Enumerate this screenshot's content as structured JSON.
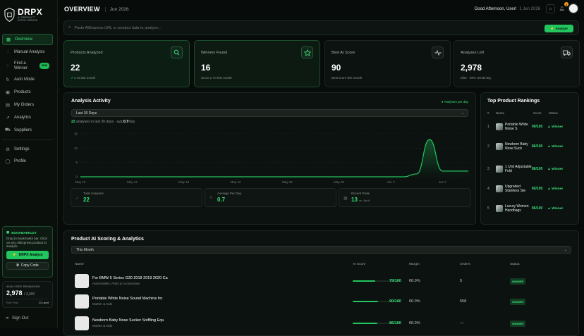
{
  "brand": {
    "name": "DRPX",
    "tagline": "AI PRODUCT INTELLIGENCE"
  },
  "sidebar": {
    "items": [
      {
        "label": "Overview",
        "icon": "grid-icon"
      },
      {
        "label": "Manual Analysis",
        "icon": "chart-icon"
      },
      {
        "label": "Find a Winner",
        "icon": "bulb-icon",
        "badge": "NEW"
      },
      {
        "label": "Auto Mode",
        "icon": "refresh-icon"
      },
      {
        "label": "Products",
        "icon": "box-icon"
      },
      {
        "label": "My Orders",
        "icon": "cart-icon"
      },
      {
        "label": "Analytics",
        "icon": "analytics-icon"
      },
      {
        "label": "Suppliers",
        "icon": "truck-icon"
      },
      {
        "label": "Settings",
        "icon": "gear-icon"
      },
      {
        "label": "Profile",
        "icon": "user-icon"
      }
    ],
    "bookmarklet": {
      "title": "BOOKMARKLET",
      "desc": "Drag to bookmarks bar. Click on any AliExpress product to analyze.",
      "drag_label": "DRPX Analyze",
      "copy_label": "Copy Code"
    },
    "remaining": {
      "label": "ANALYSES REMAINING",
      "value": "2,978",
      "total": "/ 3,000",
      "plan": "Elite Plan",
      "used": "22 used"
    },
    "signout": "Sign Out"
  },
  "header": {
    "title": "OVERVIEW",
    "date": "Jun 2026",
    "greeting": "Good Afternoon, User!",
    "greeting_date": "1 Jun 2026",
    "notif_count": "3"
  },
  "search": {
    "placeholder": "Paste AliExpress URL or product data to analyze...",
    "button": "Analyze"
  },
  "stats": [
    {
      "label": "Products Analyzed",
      "value": "22",
      "sub_up": "↗ 1",
      "sub": " vs last month",
      "icon": "search-icon"
    },
    {
      "label": "Winners Found",
      "value": "16",
      "sub_up": "",
      "sub": "Score ≥ 70 this month",
      "icon": "star-icon"
    },
    {
      "label": "Best AI Score",
      "value": "90",
      "sub_up": "",
      "sub": "Best score this month",
      "icon": "pulse-icon"
    },
    {
      "label": "Analyses Left",
      "value": "2,978",
      "sub_up": "",
      "sub": "Elite · 99% remaining",
      "icon": "truck-icon"
    }
  ],
  "activity": {
    "title": "Analysis Activity",
    "legend": "● Analyses per day",
    "range": "Last 30 Days",
    "count": "22",
    "count_text": " analyses in last 30 days · avg ",
    "avg": "0.7",
    "avg_unit": "/day",
    "mini": [
      {
        "label": "Total Analyses",
        "value": "22",
        "unit": "",
        "icon": "check-icon"
      },
      {
        "label": "Average Per Day",
        "value": "0.7",
        "unit": "",
        "icon": "equal-icon"
      },
      {
        "label": "Recent Peak",
        "value": "13",
        "unit": "on Jun 6",
        "icon": "calendar-icon"
      }
    ]
  },
  "chart_data": {
    "type": "line",
    "x": [
      "May 10",
      "May 11",
      "May 12",
      "May 13",
      "May 14",
      "May 15",
      "May 16",
      "May 17",
      "May 18",
      "May 19",
      "May 20",
      "May 21",
      "May 22",
      "May 23",
      "May 24",
      "May 25",
      "May 26",
      "May 27",
      "May 28",
      "May 29",
      "May 30",
      "May 31",
      "Jun 1",
      "Jun 2",
      "Jun 3",
      "Jun 4",
      "Jun 5",
      "Jun 6",
      "Jun 7",
      "Jun 8",
      "Jun 9"
    ],
    "xticks": [
      "May 10",
      "May 14",
      "May 18",
      "May 22",
      "May 26",
      "May 30",
      "Jun 3",
      "Jun 7"
    ],
    "values": [
      0,
      0,
      0,
      0,
      0,
      0,
      0,
      0,
      0,
      0,
      0,
      0,
      0,
      0,
      0,
      0,
      0,
      0,
      0,
      0,
      0,
      0,
      0,
      0,
      0,
      0,
      1,
      13,
      2,
      2,
      2
    ],
    "yticks": [
      0,
      5,
      10,
      15
    ],
    "ylim": [
      0,
      15
    ],
    "grid": true,
    "series_color": "#22c55e"
  },
  "rankings": {
    "title": "Top Product Rankings",
    "headers": [
      "#",
      "Name",
      "Score",
      "Status"
    ],
    "rows": [
      {
        "rank": "1",
        "name": "Portable White Noise S",
        "score": "90/100",
        "status": "▲ Winner"
      },
      {
        "rank": "2",
        "name": "Newborn Baby Nose Suck",
        "score": "86/100",
        "status": "▲ Winner"
      },
      {
        "rank": "3",
        "name": "1 Unit Adjustable Fold",
        "score": "86/100",
        "status": "▲ Winner"
      },
      {
        "rank": "4",
        "name": "Upgraded Stainless Ste",
        "score": "85/100",
        "status": "▲ Winner"
      },
      {
        "rank": "5",
        "name": "Luxury Women Handbags",
        "score": "85/100",
        "status": "▲ Winner"
      }
    ]
  },
  "table": {
    "title": "Product AI Scoring & Analytics",
    "range": "This Month",
    "headers": [
      "Name",
      "AI Score",
      "Margin",
      "Orders",
      "Status"
    ],
    "rows": [
      {
        "name": "For BMW 5 Series G30 2018 2019 2020 Ca",
        "category": "Automobiles, Parts & Accessories",
        "score": "79/100",
        "score_value": 79,
        "margin": "60.0%",
        "orders": "5",
        "status": "WINNER"
      },
      {
        "name": "Portable White Noise Sound Machine for",
        "category": "Mother & Kids",
        "score": "90/100",
        "score_value": 90,
        "margin": "60.0%",
        "orders": "558",
        "status": "WINNER"
      },
      {
        "name": "Newborn Baby Nose Sucker Sniffling Equ",
        "category": "Mother & Kids",
        "score": "86/100",
        "score_value": 86,
        "margin": "60.0%",
        "orders": "—",
        "status": "WINNER"
      }
    ]
  }
}
